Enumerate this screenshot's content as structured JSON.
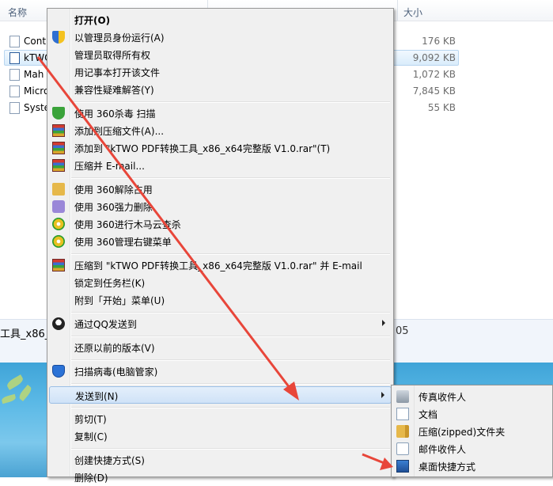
{
  "explorer": {
    "columns": {
      "name": "名称",
      "size": "大小"
    },
    "files": [
      {
        "name": "Cont",
        "size": "176 KB",
        "icon": "file-icon"
      },
      {
        "name": "kTWO",
        "size": "9,092 KB",
        "icon": "app-icon",
        "selected": true
      },
      {
        "name": "Mah",
        "size": "1,072 KB",
        "icon": "file-icon"
      },
      {
        "name": "Micro",
        "size": "7,845 KB",
        "icon": "file-icon"
      },
      {
        "name": "Syste",
        "size": "55 KB",
        "icon": "file-icon"
      }
    ],
    "status_left": "工具_x86_",
    "status_right": "05"
  },
  "context_menu": {
    "items": [
      {
        "label": "打开(O)",
        "bold": true
      },
      {
        "label": "以管理员身份运行(A)",
        "icon": "uac-shield-icon"
      },
      {
        "label": "管理员取得所有权"
      },
      {
        "label": "用记事本打开该文件"
      },
      {
        "label": "兼容性疑难解答(Y)"
      },
      {
        "label": "使用 360杀毒 扫描",
        "icon": "360-antivirus-icon"
      },
      {
        "label": "添加到压缩文件(A)...",
        "icon": "winrar-icon"
      },
      {
        "label": "添加到 \"kTWO PDF转换工具_x86_x64完整版 V1.0.rar\"(T)",
        "icon": "winrar-icon"
      },
      {
        "label": "压缩并 E-mail...",
        "icon": "winrar-icon"
      },
      {
        "label": "使用 360解除占用",
        "icon": "360-unlock-icon"
      },
      {
        "label": "使用 360强力删除",
        "icon": "360-delete-icon"
      },
      {
        "label": "使用 360进行木马云查杀",
        "icon": "360-trojan-icon"
      },
      {
        "label": "使用 360管理右键菜单",
        "icon": "360-menu-icon"
      },
      {
        "label": "压缩到 \"kTWO PDF转换工具_x86_x64完整版 V1.0.rar\" 并 E-mail",
        "icon": "winrar-icon"
      },
      {
        "label": "锁定到任务栏(K)"
      },
      {
        "label": "附到「开始」菜单(U)"
      },
      {
        "label": "通过QQ发送到",
        "icon": "qq-icon",
        "submenu": true
      },
      {
        "label": "还原以前的版本(V)"
      },
      {
        "label": "扫描病毒(电脑管家)",
        "icon": "pc-manager-icon"
      },
      {
        "label": "发送到(N)",
        "submenu": true,
        "hover": true
      },
      {
        "label": "剪切(T)"
      },
      {
        "label": "复制(C)"
      },
      {
        "label": "创建快捷方式(S)"
      },
      {
        "label": "删除(D)"
      }
    ]
  },
  "send_to_menu": {
    "items": [
      {
        "label": "传真收件人",
        "icon": "fax-icon"
      },
      {
        "label": "文档",
        "icon": "document-icon"
      },
      {
        "label": "压缩(zipped)文件夹",
        "icon": "zip-folder-icon"
      },
      {
        "label": "邮件收件人",
        "icon": "mail-icon"
      },
      {
        "label": "桌面快捷方式",
        "icon": "desktop-icon"
      }
    ]
  },
  "colors": {
    "annotation_arrow": "#e8463a",
    "menu_bg": "#f0f0f0",
    "hover_border": "#9bbee5"
  }
}
